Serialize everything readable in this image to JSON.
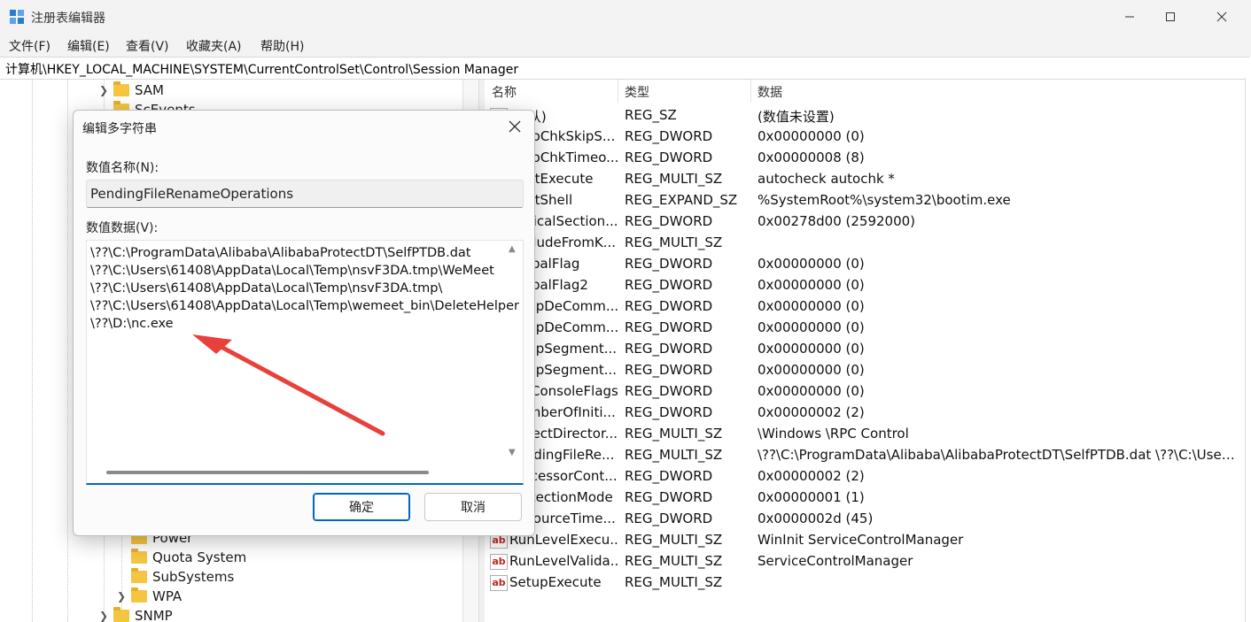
{
  "window": {
    "title": "注册表编辑器"
  },
  "menu": [
    "文件(F)",
    "编辑(E)",
    "查看(V)",
    "收藏夹(A)",
    "帮助(H)"
  ],
  "address": "计算机\\HKEY_LOCAL_MACHINE\\SYSTEM\\CurrentControlSet\\Control\\Session Manager",
  "tree": {
    "items_top": [
      "SAM",
      "ScEvents"
    ],
    "items_bottom": [
      "Power",
      "Quota System",
      "SubSystems",
      "WPA",
      "SNMP"
    ]
  },
  "values_header": {
    "name": "名称",
    "type": "类型",
    "data": "数据"
  },
  "values": [
    {
      "name": "(默认)",
      "type": "REG_SZ",
      "data": "(数值未设置)",
      "icon": "ab"
    },
    {
      "name": "AutoChkSkipS...",
      "type": "REG_DWORD",
      "data": "0x00000000 (0)",
      "icon": "num"
    },
    {
      "name": "AutoChkTimeo...",
      "type": "REG_DWORD",
      "data": "0x00000008 (8)",
      "icon": "num"
    },
    {
      "name": "BootExecute",
      "type": "REG_MULTI_SZ",
      "data": "autocheck autochk *",
      "icon": "ab"
    },
    {
      "name": "BootShell",
      "type": "REG_EXPAND_SZ",
      "data": "%SystemRoot%\\system32\\bootim.exe",
      "icon": "ab"
    },
    {
      "name": "CriticalSection...",
      "type": "REG_DWORD",
      "data": "0x00278d00 (2592000)",
      "icon": "num"
    },
    {
      "name": "ExcludeFromK...",
      "type": "REG_MULTI_SZ",
      "data": "",
      "icon": "ab"
    },
    {
      "name": "GlobalFlag",
      "type": "REG_DWORD",
      "data": "0x00000000 (0)",
      "icon": "num"
    },
    {
      "name": "GlobalFlag2",
      "type": "REG_DWORD",
      "data": "0x00000000 (0)",
      "icon": "num"
    },
    {
      "name": "HeapDeComm...",
      "type": "REG_DWORD",
      "data": "0x00000000 (0)",
      "icon": "num"
    },
    {
      "name": "HeapDeComm...",
      "type": "REG_DWORD",
      "data": "0x00000000 (0)",
      "icon": "num"
    },
    {
      "name": "HeapSegment...",
      "type": "REG_DWORD",
      "data": "0x00000000 (0)",
      "icon": "num"
    },
    {
      "name": "HeapSegment...",
      "type": "REG_DWORD",
      "data": "0x00000000 (0)",
      "icon": "num"
    },
    {
      "name": "InitConsoleFlags",
      "type": "REG_DWORD",
      "data": "0x00000000 (0)",
      "icon": "num"
    },
    {
      "name": "NumberOfIniti...",
      "type": "REG_DWORD",
      "data": "0x00000002 (2)",
      "icon": "num"
    },
    {
      "name": "ObjectDirector...",
      "type": "REG_MULTI_SZ",
      "data": "\\Windows \\RPC Control",
      "icon": "ab"
    },
    {
      "name": "PendingFileRe...",
      "type": "REG_MULTI_SZ",
      "data": "\\??\\C:\\ProgramData\\Alibaba\\AlibabaProtectDT\\SelfPTDB.dat \\??\\C:\\Users...",
      "icon": "ab"
    },
    {
      "name": "ProcessorCont...",
      "type": "REG_DWORD",
      "data": "0x00000002 (2)",
      "icon": "num"
    },
    {
      "name": "ProtectionMode",
      "type": "REG_DWORD",
      "data": "0x00000001 (1)",
      "icon": "num"
    },
    {
      "name": "ResourceTime...",
      "type": "REG_DWORD",
      "data": "0x0000002d (45)",
      "icon": "num"
    },
    {
      "name": "RunLevelExecu...",
      "type": "REG_MULTI_SZ",
      "data": "WinInit ServiceControlManager",
      "icon": "ab"
    },
    {
      "name": "RunLevelValida...",
      "type": "REG_MULTI_SZ",
      "data": "ServiceControlManager",
      "icon": "ab"
    },
    {
      "name": "SetupExecute",
      "type": "REG_MULTI_SZ",
      "data": "",
      "icon": "ab"
    }
  ],
  "dialog": {
    "title": "编辑多字符串",
    "name_label": "数值名称(N):",
    "name_value": "PendingFileRenameOperations",
    "data_label": "数值数据(V):",
    "data_lines": [
      "\\??\\C:\\ProgramData\\Alibaba\\AlibabaProtectDT\\SelfPTDB.dat",
      "\\??\\C:\\Users\\61408\\AppData\\Local\\Temp\\nsvF3DA.tmp\\WeMeet",
      "\\??\\C:\\Users\\61408\\AppData\\Local\\Temp\\nsvF3DA.tmp\\",
      "\\??\\C:\\Users\\61408\\AppData\\Local\\Temp\\wemeet_bin\\DeleteHelper",
      "\\??\\D:\\nc.exe"
    ],
    "ok": "确定",
    "cancel": "取消"
  },
  "annotation_color": "#e8403a"
}
